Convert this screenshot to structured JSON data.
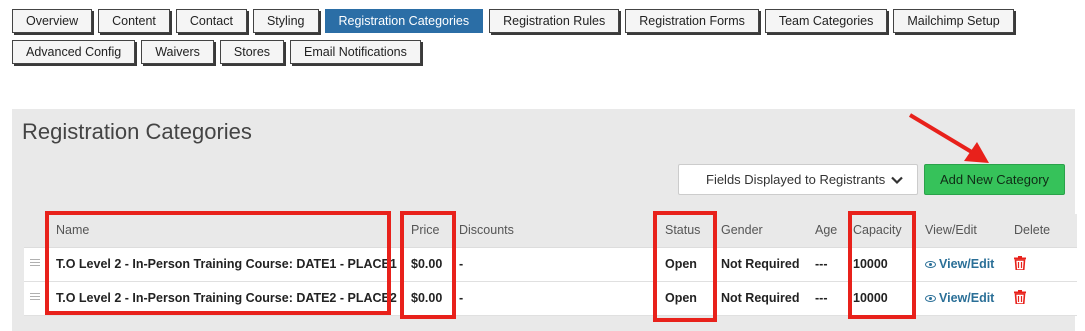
{
  "tabs": {
    "row1": [
      {
        "label": "Overview",
        "active": false
      },
      {
        "label": "Content",
        "active": false
      },
      {
        "label": "Contact",
        "active": false
      },
      {
        "label": "Styling",
        "active": false
      },
      {
        "label": "Registration Categories",
        "active": true
      },
      {
        "label": "Registration Rules",
        "active": false
      },
      {
        "label": "Registration Forms",
        "active": false
      },
      {
        "label": "Team Categories",
        "active": false
      },
      {
        "label": "Mailchimp Setup",
        "active": false
      }
    ],
    "row2": [
      {
        "label": "Advanced Config",
        "active": false
      },
      {
        "label": "Waivers",
        "active": false
      },
      {
        "label": "Stores",
        "active": false
      },
      {
        "label": "Email Notifications",
        "active": false
      }
    ]
  },
  "panel": {
    "title": "Registration Categories",
    "fields_select": "Fields Displayed to Registrants",
    "add_button": "Add New Category"
  },
  "table": {
    "headers": {
      "name": "Name",
      "price": "Price",
      "discounts": "Discounts",
      "status": "Status",
      "gender": "Gender",
      "age": "Age",
      "capacity": "Capacity",
      "view_edit": "View/Edit",
      "delete": "Delete"
    },
    "rows": [
      {
        "name": "T.O Level 2 - In-Person Training Course: DATE1 - PLACE1",
        "price": "$0.00",
        "discounts": "-",
        "status": "Open",
        "gender": "Not Required",
        "age": "---",
        "capacity": "10000",
        "view": "View/Edit"
      },
      {
        "name": "T.O Level 2 - In-Person Training Course: DATE2 - PLACE2",
        "price": "$0.00",
        "discounts": "-",
        "status": "Open",
        "gender": "Not Required",
        "age": "---",
        "capacity": "10000",
        "view": "View/Edit"
      }
    ]
  },
  "colors": {
    "active_tab": "#2b6ea6",
    "add_button": "#36c25a",
    "highlight": "#e8211b",
    "link": "#2a6f97",
    "delete": "#e8211b"
  },
  "icons": [
    "drag-handle-icon",
    "chevron-down-icon",
    "eye-icon",
    "trash-icon",
    "arrow-annotation"
  ]
}
